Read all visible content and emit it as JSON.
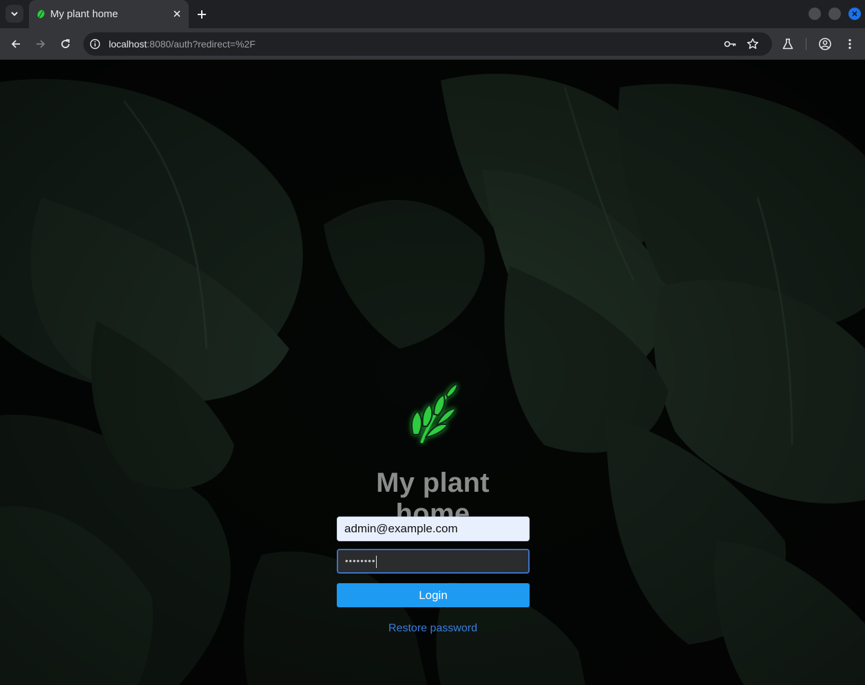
{
  "browser": {
    "tab_title": "My plant home",
    "url_host": "localhost",
    "url_rest": ":8080/auth?redirect=%2F"
  },
  "icons": {
    "tab_search": "chevron-down-icon",
    "favicon": "plant-leaf-icon",
    "tab_close": "close-icon",
    "new_tab": "plus-icon",
    "back": "arrow-left-icon",
    "forward": "arrow-right-icon",
    "reload": "reload-icon",
    "site_info": "info-icon",
    "passwords": "key-icon",
    "bookmark": "star-icon",
    "labs": "flask-icon",
    "profile": "account-circle-icon",
    "menu": "kebab-menu-icon"
  },
  "login": {
    "app_title": "My plant home",
    "email_value": "admin@example.com",
    "password_mask": "••••••••",
    "login_label": "Login",
    "restore_label": "Restore password"
  },
  "colors": {
    "accent": "#1e9bf0",
    "link": "#3b7ddd",
    "logo_green": "#2ecc40"
  }
}
